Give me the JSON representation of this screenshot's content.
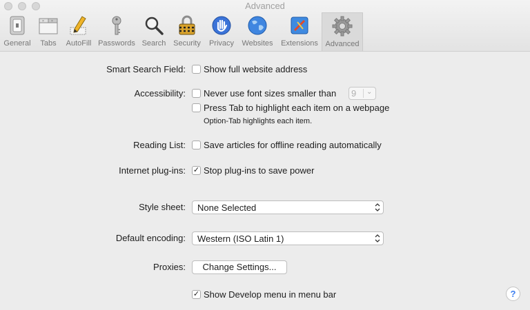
{
  "window": {
    "title": "Advanced"
  },
  "toolbar": {
    "items": [
      {
        "label": "General",
        "icon": "general-switch-icon"
      },
      {
        "label": "Tabs",
        "icon": "tabs-icon"
      },
      {
        "label": "AutoFill",
        "icon": "autofill-pencil-icon"
      },
      {
        "label": "Passwords",
        "icon": "key-icon"
      },
      {
        "label": "Search",
        "icon": "magnifier-icon"
      },
      {
        "label": "Security",
        "icon": "padlock-icon"
      },
      {
        "label": "Privacy",
        "icon": "hand-icon"
      },
      {
        "label": "Websites",
        "icon": "globe-icon"
      },
      {
        "label": "Extensions",
        "icon": "puzzle-icon"
      },
      {
        "label": "Advanced",
        "icon": "gear-icon",
        "active": true
      }
    ]
  },
  "smart_search": {
    "label": "Smart Search Field:",
    "checkbox": {
      "text": "Show full website address",
      "checked": false
    }
  },
  "accessibility": {
    "label": "Accessibility:",
    "font_size": {
      "text": "Never use font sizes smaller than",
      "checked": false,
      "value": "9"
    },
    "tab_highlight": {
      "text": "Press Tab to highlight each item on a webpage",
      "checked": false
    },
    "note": "Option-Tab highlights each item."
  },
  "reading_list": {
    "label": "Reading List:",
    "checkbox": {
      "text": "Save articles for offline reading automatically",
      "checked": false
    }
  },
  "plugins": {
    "label": "Internet plug-ins:",
    "checkbox": {
      "text": "Stop plug-ins to save power",
      "checked": true
    }
  },
  "style_sheet": {
    "label": "Style sheet:",
    "value": "None Selected"
  },
  "encoding": {
    "label": "Default encoding:",
    "value": "Western (ISO Latin 1)"
  },
  "proxies": {
    "label": "Proxies:",
    "button": "Change Settings..."
  },
  "develop": {
    "text": "Show Develop menu in menu bar",
    "checked": true
  },
  "help": {
    "label": "?"
  },
  "colors": {
    "accent": "#3d7ff0",
    "background": "#ececec"
  }
}
